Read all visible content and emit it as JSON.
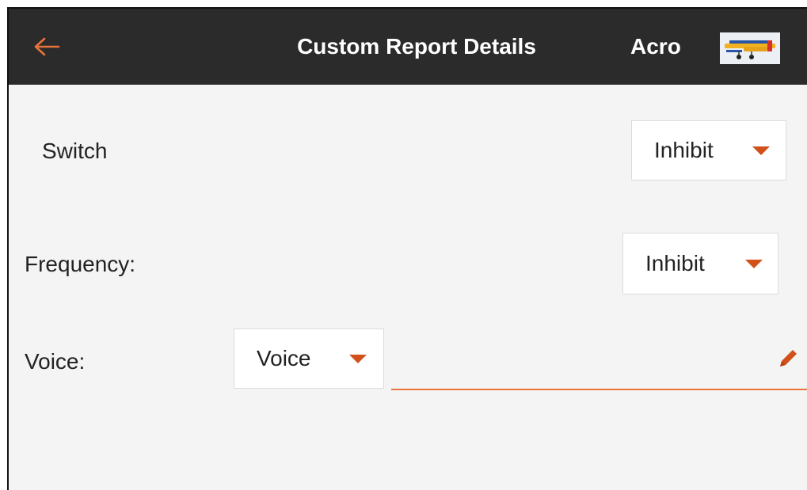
{
  "header": {
    "title": "Custom Report Details",
    "model_name": "Acro",
    "back_icon": "arrow-left-icon",
    "accent_color": "#e8743b"
  },
  "rows": {
    "switch": {
      "label": "Switch",
      "value": "Inhibit"
    },
    "frequency": {
      "label": "Frequency:",
      "value": "Inhibit"
    },
    "voice": {
      "label": "Voice:",
      "value": "Voice",
      "text_value": "",
      "edit_icon": "pencil-icon"
    }
  },
  "colors": {
    "header_bg": "#2b2b2b",
    "caret": "#d2501a",
    "underline": "#e8743b"
  }
}
